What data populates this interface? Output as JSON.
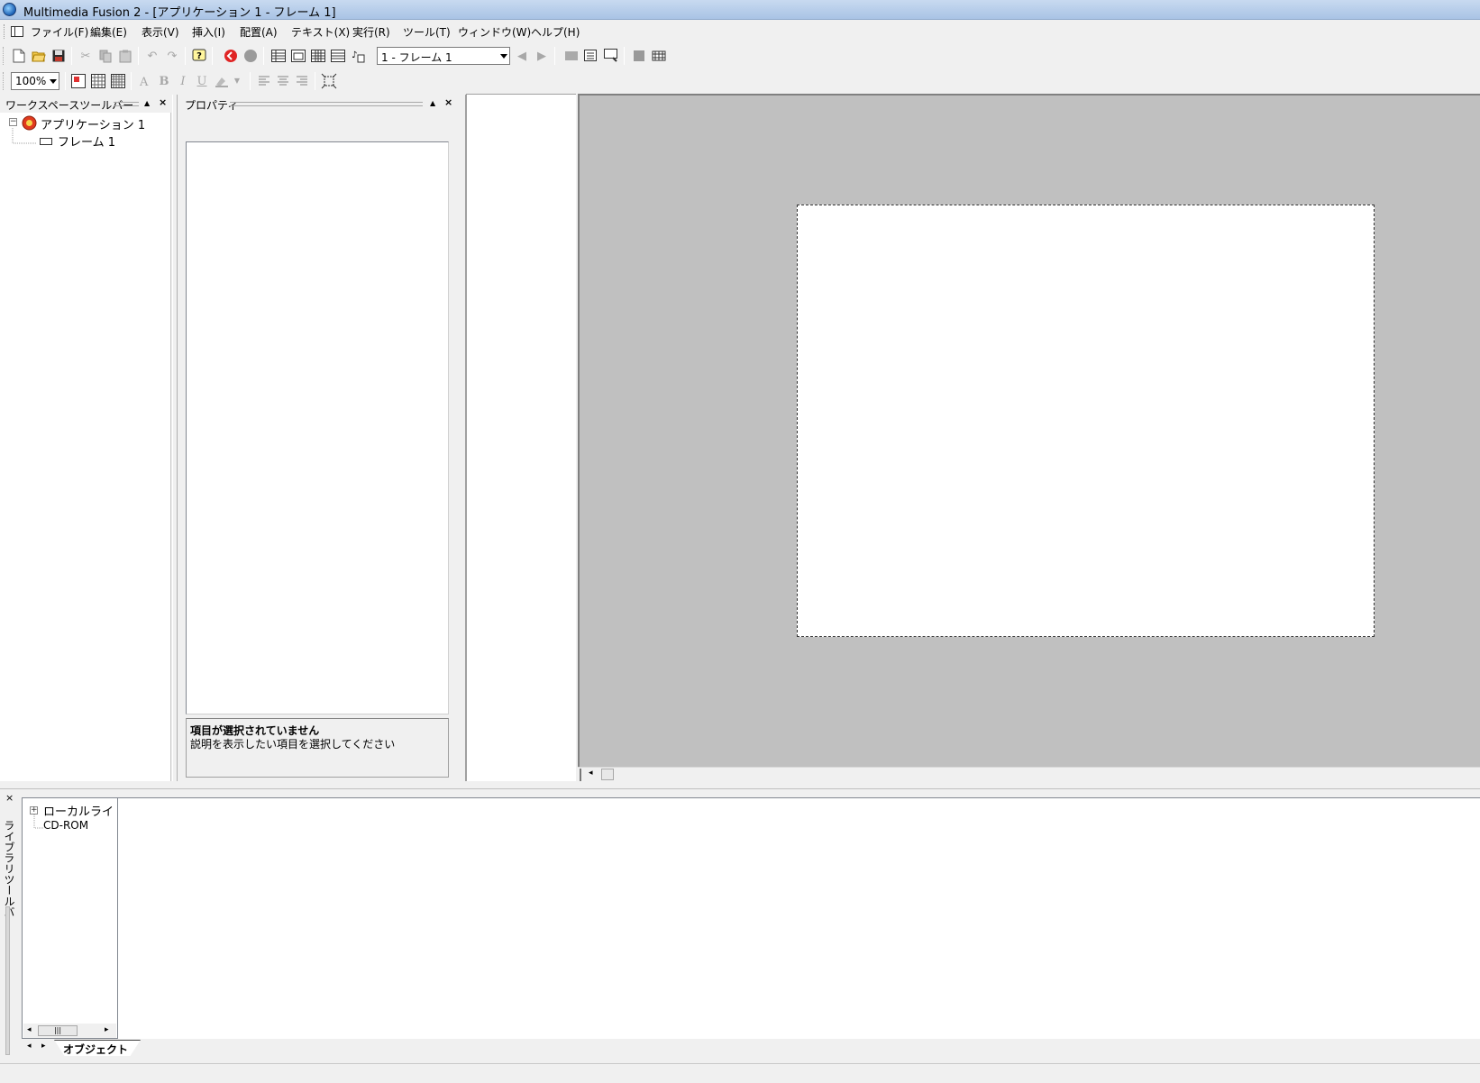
{
  "window": {
    "title": "Multimedia Fusion 2 - [アプリケーション 1 - フレーム 1]"
  },
  "menu": {
    "items": [
      {
        "label": "ファイル(F)"
      },
      {
        "label": "編集(E)"
      },
      {
        "label": "表示(V)"
      },
      {
        "label": "挿入(I)"
      },
      {
        "label": "配置(A)"
      },
      {
        "label": "テキスト(X)"
      },
      {
        "label": "実行(R)"
      },
      {
        "label": "ツール(T)"
      },
      {
        "label": "ウィンドウ(W)"
      },
      {
        "label": "ヘルプ(H)"
      }
    ]
  },
  "toolbar": {
    "frame_select": {
      "value": "1 - フレーム 1"
    },
    "zoom_select": {
      "value": "100%"
    },
    "bold_label": "B",
    "italic_label": "I",
    "underline_label": "U"
  },
  "workspace": {
    "title": "ワークスペースツールバー",
    "tree": [
      {
        "label": "アプリケーション 1"
      },
      {
        "label": "フレーム 1"
      }
    ]
  },
  "properties": {
    "title": "プロパティ",
    "description_title": "項目が選択されていません",
    "description_body": "説明を表示したい項目を選択してください"
  },
  "library": {
    "title": "ライブラリツールバー",
    "tree": [
      {
        "label": "ローカルライ"
      },
      {
        "label": "CD-ROM"
      }
    ],
    "tab": "オブジェクト"
  },
  "colors": {
    "editor_background": "#c0c0c0",
    "frame_background": "#ffffff",
    "titlebar": "#b9cfea"
  }
}
